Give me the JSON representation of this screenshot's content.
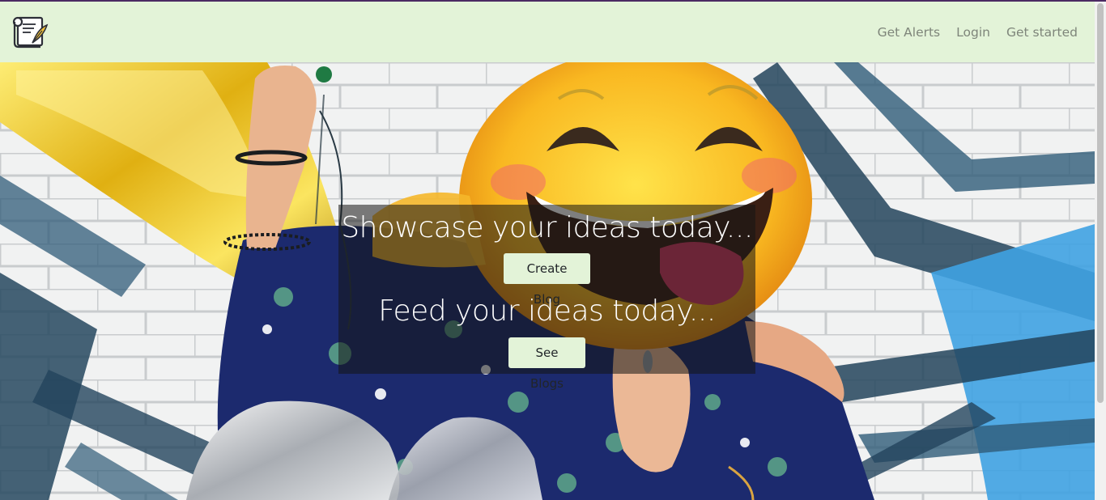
{
  "navbar": {
    "brand_icon": "scroll-quill-logo-icon",
    "links": [
      {
        "label": "Get Alerts"
      },
      {
        "label": "Login"
      },
      {
        "label": "Get started"
      }
    ],
    "background": "#e3f3d8",
    "link_color": "#7e857a"
  },
  "hero": {
    "title_1": "Showcase your ideas today...",
    "button_1": "Create Blog",
    "title_2": "Feed your ideas today...",
    "button_2": "See Blogs",
    "background_image": "woman with emoji balloon in front of graffiti brick wall",
    "button_color": "#e3f3d8"
  }
}
